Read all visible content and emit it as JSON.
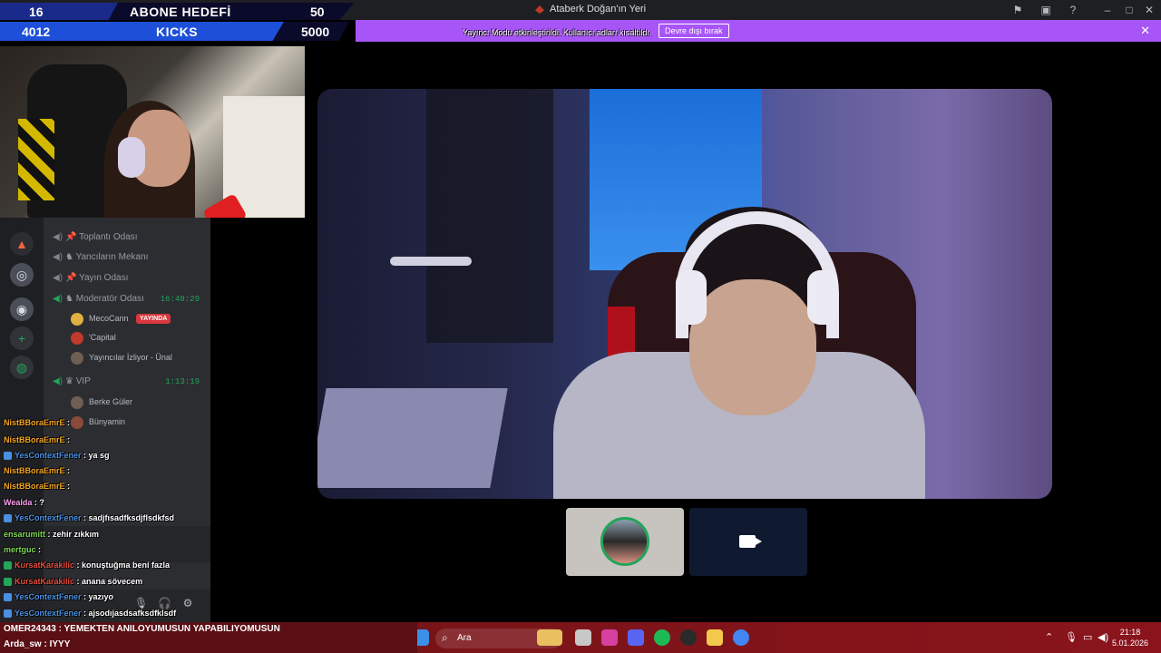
{
  "window": {
    "title": "Ataberk Doğan'ın Yeri"
  },
  "goal_overlay": {
    "row1_left": "16",
    "row1_label": "ABONE HEDEFİ",
    "row1_right": "50",
    "row2_left": "4012",
    "row2_label": "KICKS",
    "row2_right": "5000"
  },
  "streamer_mode": {
    "message": "Yayıncı Modu etkinleştirildi. Kullanıcı adları kısaltıldı.",
    "button": "Devre dışı bırak"
  },
  "channels": [
    {
      "name": "Toplantı Odası"
    },
    {
      "name": "Yancıların Mekanı"
    },
    {
      "name": "Yayın Odası"
    },
    {
      "name": "Moderatör Odası",
      "time": "16:48:29"
    }
  ],
  "voice_users": [
    {
      "name": "MecoCann",
      "badge": "YAYINDA"
    },
    {
      "name": "'Capital"
    },
    {
      "name": "Yayıncılar İzliyor - Ünal"
    }
  ],
  "vip_channel": {
    "name": "VIP",
    "time": "1:13:19"
  },
  "vip_users": [
    {
      "name": "Berke Güler"
    },
    {
      "name": "Bünyamin"
    }
  ],
  "chat": [
    {
      "nick": "NistBBoraEmrE",
      "text": "",
      "color": "#f5a623"
    },
    {
      "nick": "NistBBoraEmrE",
      "text": "",
      "color": "#f5a623"
    },
    {
      "nick": "YesContextFener",
      "text": "ya sg",
      "color": "#4a90e2"
    },
    {
      "nick": "NistBBoraEmrE",
      "text": "",
      "color": "#f5a623"
    },
    {
      "nick": "NistBBoraEmrE",
      "text": "",
      "color": "#f5a623"
    },
    {
      "nick": "Wealda",
      "text": "?",
      "color": "#ff9ff3"
    },
    {
      "nick": "YesContextFener",
      "text": "sadjfısadfksdjflsdkfsd",
      "color": "#4a90e2"
    },
    {
      "nick": "ensarumitt",
      "text": "zehir zıkkım",
      "color": "#7ed957"
    },
    {
      "nick": "mertguc",
      "text": "",
      "color": "#7ed957"
    },
    {
      "nick": "KursatKarakilic",
      "text": "konuştuğma beni fazla",
      "color": "#e74c3c"
    },
    {
      "nick": "KursatKarakilic",
      "text": "anana sövecem",
      "color": "#e74c3c"
    },
    {
      "nick": "YesContextFener",
      "text": "yazıyo",
      "color": "#4a90e2"
    },
    {
      "nick": "YesContextFener",
      "text": "ajsodıjasdsafksdfklsdf",
      "color": "#4a90e2"
    }
  ],
  "marquee": {
    "line1": "OMER24343 : YEMEKTEN ANILOYUMUSUN YAPABILIYOMUSUN",
    "line2": "Arda_sw : IYYY"
  },
  "taskbar": {
    "search_label": "Ara",
    "time": "21:18",
    "date": "5.01.2026"
  },
  "accent": {
    "streamer_bar": "#a855f7",
    "speaking": "#23a55a"
  }
}
